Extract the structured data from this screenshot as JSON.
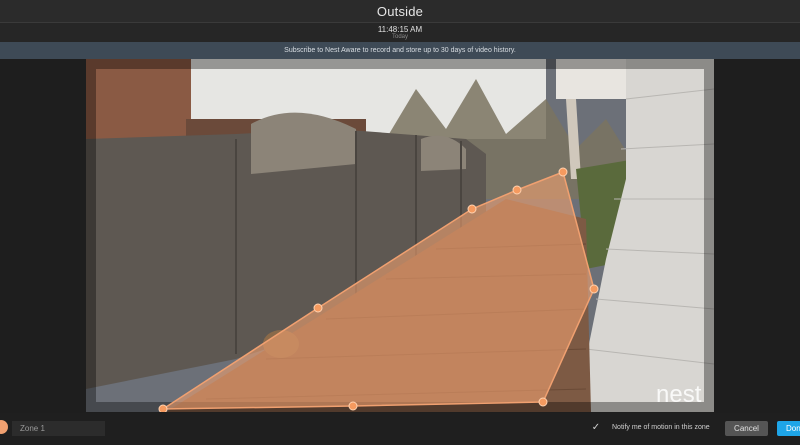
{
  "header": {
    "title": "Outside",
    "time": "11:48:15 AM",
    "day": "Today"
  },
  "banner": {
    "text": "Subscribe to Nest Aware to record and store up to 30 days of video history."
  },
  "video": {
    "watermark": "nest",
    "zone_color": "#f0a070"
  },
  "footer": {
    "zone_name": "Zone 1",
    "notify_checked": true,
    "notify_label": "Notify me of motion in this zone",
    "cancel_label": "Cancel",
    "done_label": "Done"
  },
  "colors": {
    "accent": "#1ea5e8",
    "zone": "#f0a070",
    "banner_bg": "#3e4a56"
  }
}
